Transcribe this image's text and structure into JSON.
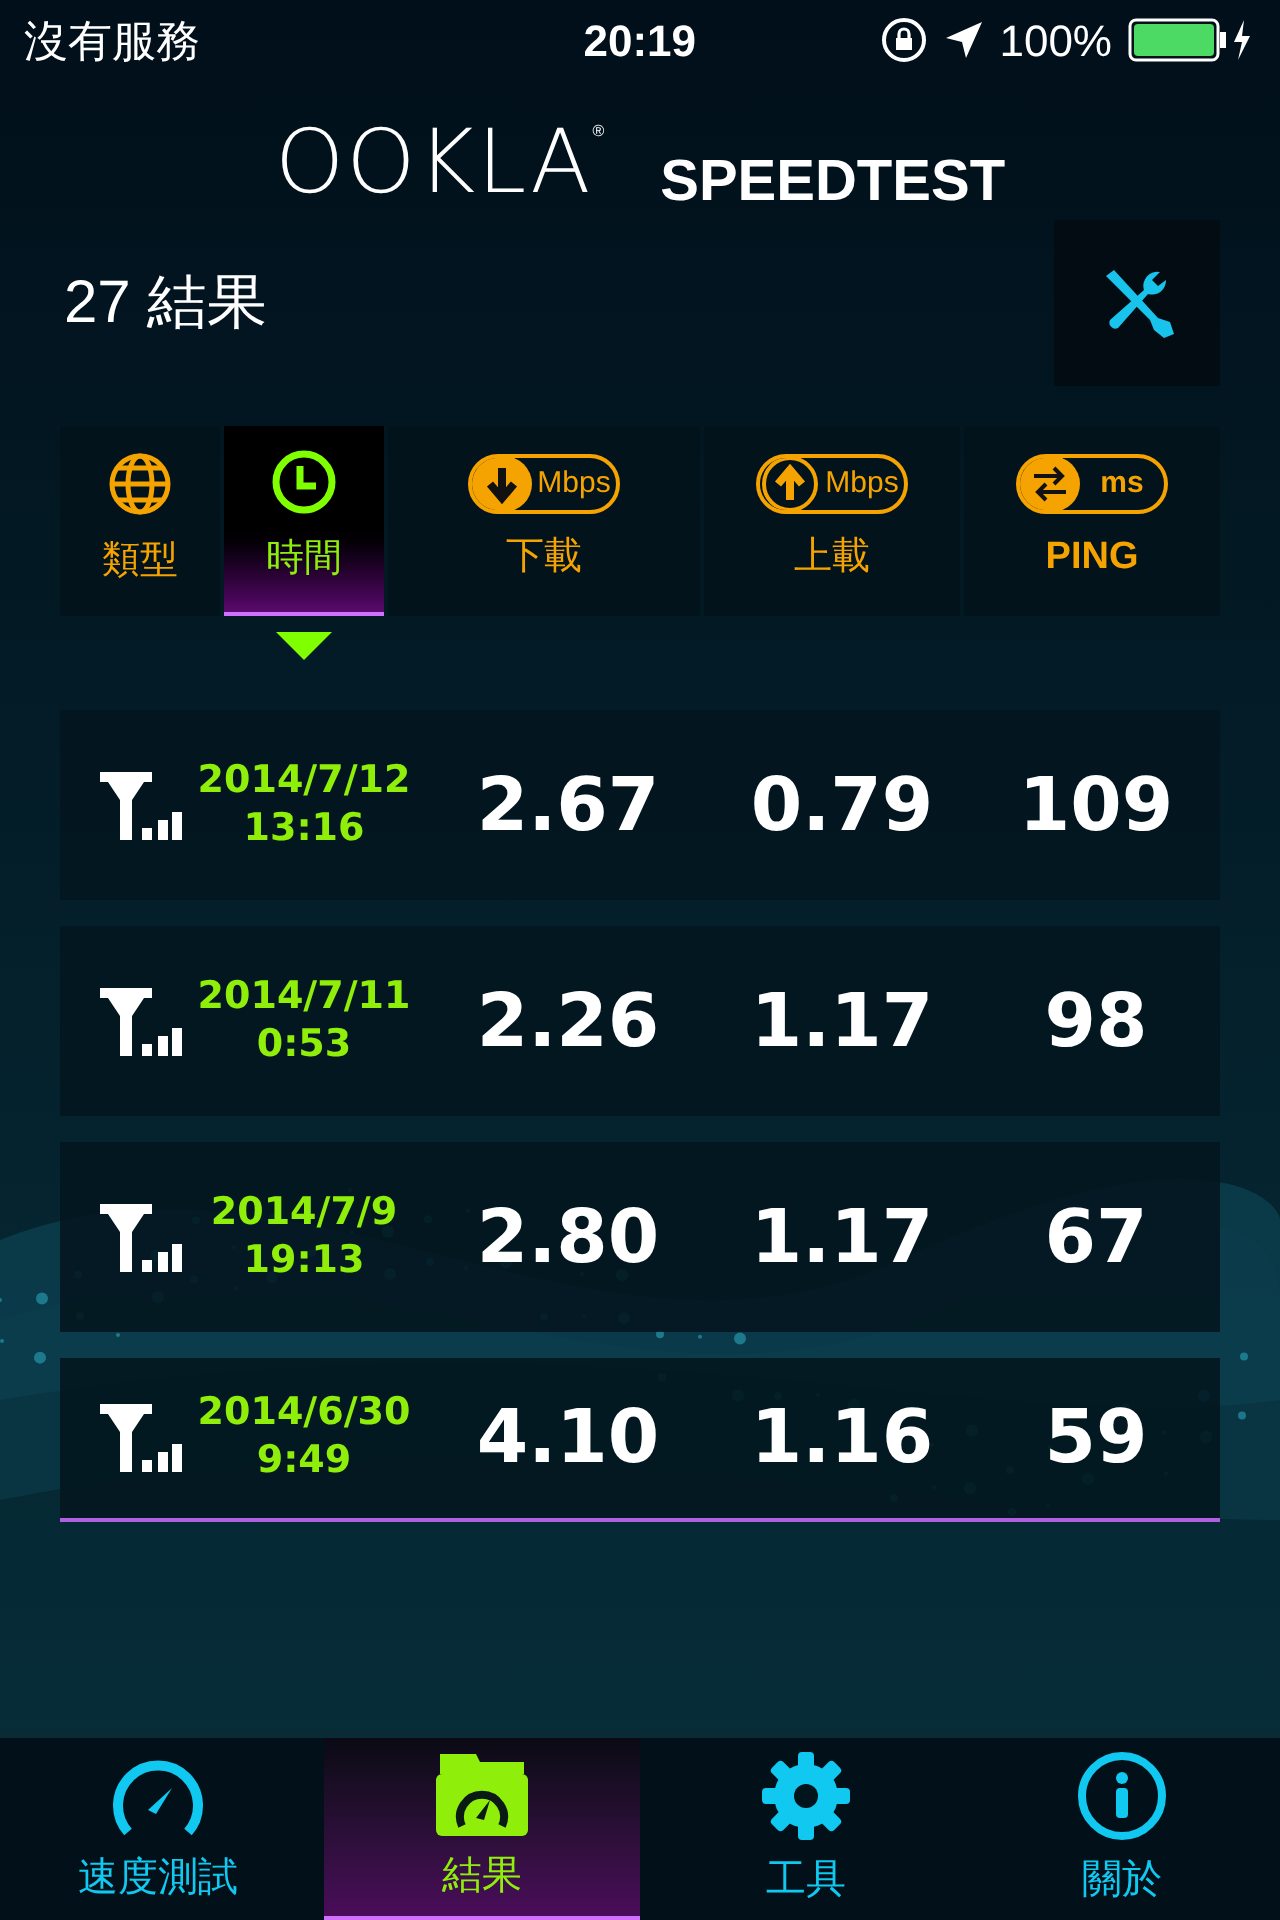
{
  "status_bar": {
    "carrier": "沒有服務",
    "time": "20:19",
    "battery": "100%"
  },
  "logo": {
    "brand": "OOKLA",
    "mark": "®",
    "product": "SPEEDTEST"
  },
  "results_count": "27 結果",
  "columns": [
    {
      "kind": "globe",
      "label": "類型",
      "selected": false
    },
    {
      "kind": "clock",
      "label": "時間",
      "selected": true
    },
    {
      "kind": "download",
      "unit": "Mbps",
      "label": "下載",
      "selected": false
    },
    {
      "kind": "upload",
      "unit": "Mbps",
      "label": "上載",
      "selected": false
    },
    {
      "kind": "ping",
      "unit": "ms",
      "label": "PING",
      "selected": false
    }
  ],
  "rows": [
    {
      "date": "2014/7/12",
      "time": "13:16",
      "download": "2.67",
      "upload": "0.79",
      "ping": "109",
      "selected": false
    },
    {
      "date": "2014/7/11",
      "time": "0:53",
      "download": "2.26",
      "upload": "1.17",
      "ping": "98",
      "selected": false
    },
    {
      "date": "2014/7/9",
      "time": "19:13",
      "download": "2.80",
      "upload": "1.17",
      "ping": "67",
      "selected": false
    },
    {
      "date": "2014/6/30",
      "time": "9:49",
      "download": "4.10",
      "upload": "1.16",
      "ping": "59",
      "selected": true
    }
  ],
  "tab_bar": [
    {
      "kind": "speed",
      "label": "速度測試",
      "selected": false
    },
    {
      "kind": "results",
      "label": "結果",
      "selected": true
    },
    {
      "kind": "tools",
      "label": "工具",
      "selected": false
    },
    {
      "kind": "about",
      "label": "關於",
      "selected": false
    }
  ]
}
